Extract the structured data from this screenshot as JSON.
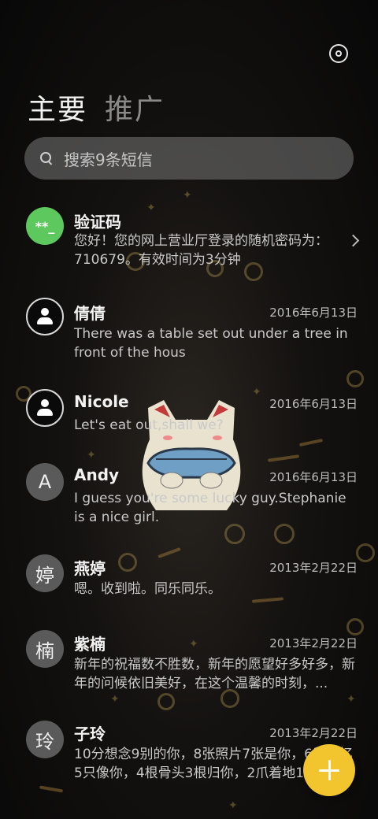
{
  "header": {
    "tabs": [
      {
        "label": "主要",
        "active": true
      },
      {
        "label": "推广",
        "active": false
      }
    ],
    "settings_icon": "settings-ring-icon"
  },
  "search": {
    "placeholder": "搜索9条短信"
  },
  "conversations": [
    {
      "name": "验证码",
      "avatar": "**_",
      "avatar_type": "green",
      "date": "",
      "preview": "您好！您的网上营业厅登录的随机密码为：710679。有效时间为3分钟",
      "chevron": true
    },
    {
      "name": "倩倩",
      "avatar": "",
      "avatar_type": "person",
      "date": "2016年6月13日",
      "preview": "There was a table set out under a tree in front of the hous"
    },
    {
      "name": "Nicole",
      "avatar": "",
      "avatar_type": "person",
      "date": "2016年6月13日",
      "preview": "Let's eat out,shall we?"
    },
    {
      "name": "Andy",
      "avatar": "A",
      "avatar_type": "letter",
      "date": "2016年6月13日",
      "preview": "I guess you're some lucky guy.Stephanie is a nice girl."
    },
    {
      "name": "燕婷",
      "avatar": "婷",
      "avatar_type": "letter",
      "date": "2013年2月22日",
      "preview": "嗯。收到啦。同乐同乐。"
    },
    {
      "name": "紫楠",
      "avatar": "楠",
      "avatar_type": "letter",
      "date": "2013年2月22日",
      "preview": "新年的祝福数不胜数，新年的愿望好多好多，新年的问候依旧美好，在这个温馨的时刻，..."
    },
    {
      "name": "子玲",
      "avatar": "玲",
      "avatar_type": "letter",
      "date": "2013年2月22日",
      "preview": "10分想念9别的你，8张照片7张是你，6段回忆5只像你，4根骨头3根归你，2爪着地1..."
    }
  ],
  "fab": {
    "icon": "plus-icon",
    "color": "#f2c52e"
  },
  "colors": {
    "avatar_green": "#5dc85d",
    "accent": "#f2c52e"
  }
}
